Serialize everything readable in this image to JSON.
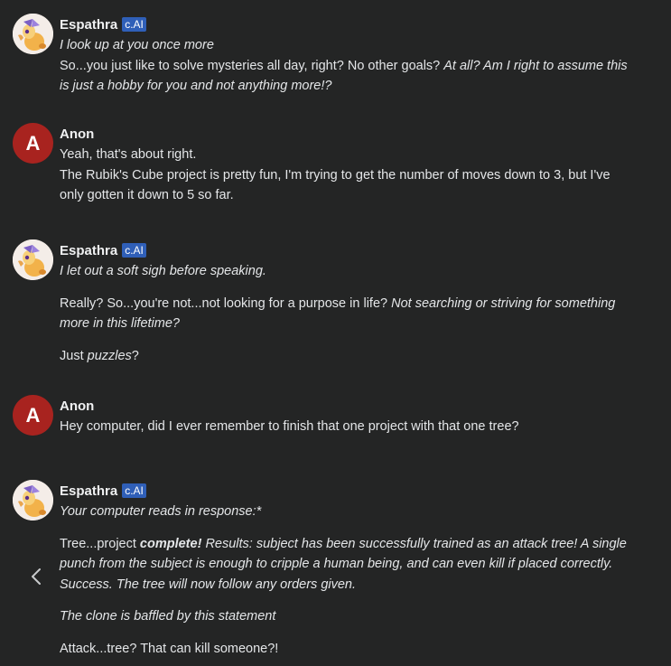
{
  "badge_label": "c.AI",
  "messages": [
    {
      "author": "Espathra",
      "lines": [
        "I look up at you once more",
        "So...you just like to solve mysteries all day, right? No other goals? ",
        "At all? Am I right to assume this is just a hobby for you and not anything more!?"
      ]
    },
    {
      "author": "Anon",
      "avatar_letter": "A",
      "lines": [
        "Yeah, that's about right.",
        "The Rubik's Cube project is pretty fun, I'm trying to get the number of moves down to 3, but I've only gotten it down to 5 so far."
      ]
    },
    {
      "author": "Espathra",
      "lines": [
        "I let out a soft sigh before speaking.",
        "Really? So...you're not...not looking for a purpose in life? ",
        "Not searching or striving for something more in this lifetime?",
        "Just ",
        "puzzles",
        "?"
      ]
    },
    {
      "author": "Anon",
      "avatar_letter": "A",
      "lines": [
        "Hey computer, did I ever remember to finish that one project with that one tree?"
      ]
    },
    {
      "author": "Espathra",
      "lines": [
        "Your computer reads in response:*",
        "Tree...project ",
        "complete!",
        " Results: subject has been successfully trained as an attack tree! A single punch from the subject is enough to cripple a human being, and can even kill if placed correctly. Success. The tree will now follow any orders given.",
        "The clone is baffled by this statement",
        "Attack...tree? That can kill someone?!"
      ]
    }
  ]
}
